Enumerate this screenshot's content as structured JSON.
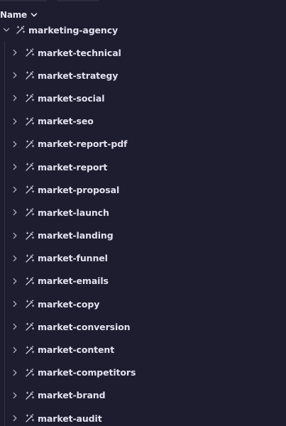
{
  "header": {
    "label": "Name",
    "sort_icon": "chevron-down-icon"
  },
  "tree": {
    "root": {
      "label": "marketing-agency",
      "icon": "wand-icon",
      "expanded": true
    },
    "children": [
      {
        "label": "market-technical"
      },
      {
        "label": "market-strategy"
      },
      {
        "label": "market-social"
      },
      {
        "label": "market-seo"
      },
      {
        "label": "market-report-pdf"
      },
      {
        "label": "market-report"
      },
      {
        "label": "market-proposal"
      },
      {
        "label": "market-launch"
      },
      {
        "label": "market-landing"
      },
      {
        "label": "market-funnel"
      },
      {
        "label": "market-emails"
      },
      {
        "label": "market-copy"
      },
      {
        "label": "market-conversion"
      },
      {
        "label": "market-content"
      },
      {
        "label": "market-competitors"
      },
      {
        "label": "market-brand"
      },
      {
        "label": "market-audit"
      }
    ]
  },
  "colors": {
    "background": "#1e1d2f",
    "text": "#e4e1f0",
    "icon": "#c9c5da",
    "chevron": "#a9a5bd"
  }
}
